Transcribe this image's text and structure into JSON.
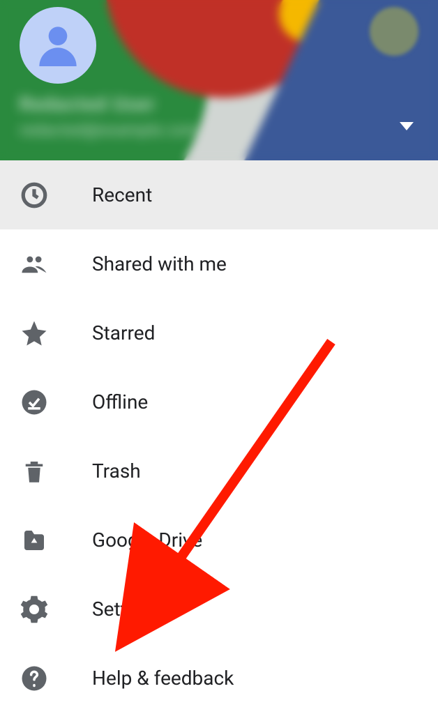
{
  "header": {
    "user_name": "Redacted User",
    "user_email": "redacted@example.com"
  },
  "menu": {
    "items": [
      {
        "label": "Recent",
        "icon": "clock-icon",
        "selected": true
      },
      {
        "label": "Shared with me",
        "icon": "people-icon",
        "selected": false
      },
      {
        "label": "Starred",
        "icon": "star-icon",
        "selected": false
      },
      {
        "label": "Offline",
        "icon": "offline-icon",
        "selected": false
      },
      {
        "label": "Trash",
        "icon": "trash-icon",
        "selected": false
      },
      {
        "label": "Google Drive",
        "icon": "drive-icon",
        "selected": false
      },
      {
        "label": "Settings",
        "icon": "gear-icon",
        "selected": false
      },
      {
        "label": "Help & feedback",
        "icon": "help-icon",
        "selected": false
      }
    ]
  },
  "annotation": {
    "target": "Settings",
    "color": "#ff1a00"
  }
}
